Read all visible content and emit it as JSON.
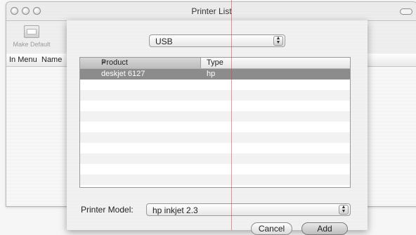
{
  "window": {
    "title": "Printer List",
    "toolbar": {
      "make_default_label": "Make Default"
    },
    "columns": [
      "In Menu",
      "Name"
    ]
  },
  "sheet": {
    "connection": {
      "selected": "USB"
    },
    "printer_list": {
      "columns": {
        "product": "Product",
        "type": "Type"
      },
      "rows": [
        {
          "product": "deskjet 6127",
          "type": "hp",
          "selected": true
        }
      ]
    },
    "printer_model": {
      "label": "Printer Model:",
      "selected": "hp inkjet 2.3"
    },
    "buttons": {
      "cancel": "Cancel",
      "add": "Add"
    }
  },
  "colors": {
    "selection": "#8c8c8c",
    "guide_line": "#dc3c3c"
  }
}
